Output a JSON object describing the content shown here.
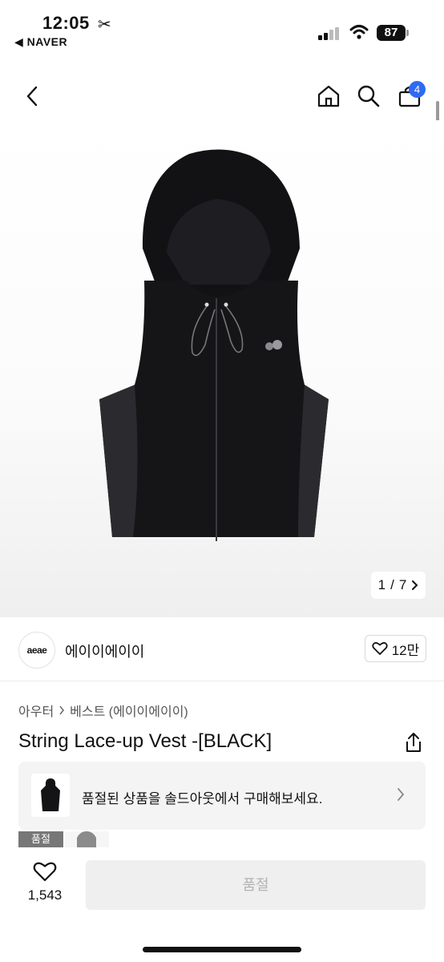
{
  "status_bar": {
    "time": "12:05",
    "scissor": "✂",
    "back_app": "◀ NAVER",
    "battery": "87"
  },
  "nav": {
    "cart_count": "4"
  },
  "gallery": {
    "current": "1",
    "separator": "/",
    "total": "7"
  },
  "brand": {
    "logo_text": "aeae",
    "name": "에이이에이이",
    "likes": "12만"
  },
  "breadcrumb": {
    "category": "아우터",
    "sub_category": "베스트 (에이이에이이)"
  },
  "product": {
    "title": "String Lace-up Vest -[BLACK]"
  },
  "soldout_banner": {
    "text": "품절된 상품을 솔드아웃에서 구매해보세요."
  },
  "option_thumbs": {
    "first_label": "품절"
  },
  "bottom_bar": {
    "wish_count": "1,543",
    "buy_label": "품절"
  },
  "colors": {
    "accent": "#2f6bf2",
    "disabled_bg": "#efefef",
    "disabled_text": "#b3b3b3"
  }
}
